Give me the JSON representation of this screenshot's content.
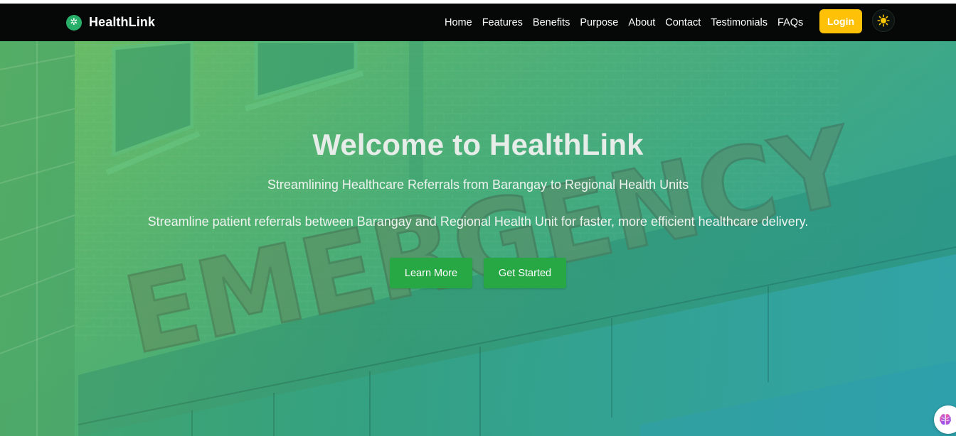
{
  "brand": {
    "name": "HealthLink",
    "icon": "asterisk-medical-icon",
    "icon_color": "#28b06a"
  },
  "nav": {
    "items": [
      {
        "label": "Home"
      },
      {
        "label": "Features"
      },
      {
        "label": "Benefits"
      },
      {
        "label": "Purpose"
      },
      {
        "label": "About"
      },
      {
        "label": "Contact"
      },
      {
        "label": "Testimonials"
      },
      {
        "label": "FAQs"
      }
    ],
    "login_label": "Login",
    "login_color": "#ffc107",
    "theme_toggle_icon": "sun-icon"
  },
  "hero": {
    "background_sign": "EMERGENCY",
    "title": "Welcome to HealthLink",
    "subtitle": "Streamlining Healthcare Referrals from Barangay to Regional Health Units",
    "description": "Streamline patient referrals between Barangay and Regional Health Unit for faster, more efficient healthcare delivery.",
    "buttons": {
      "learn_more": "Learn More",
      "get_started": "Get Started"
    },
    "button_color": "#28a745"
  },
  "chat_widget": {
    "icon": "brain-icon"
  }
}
